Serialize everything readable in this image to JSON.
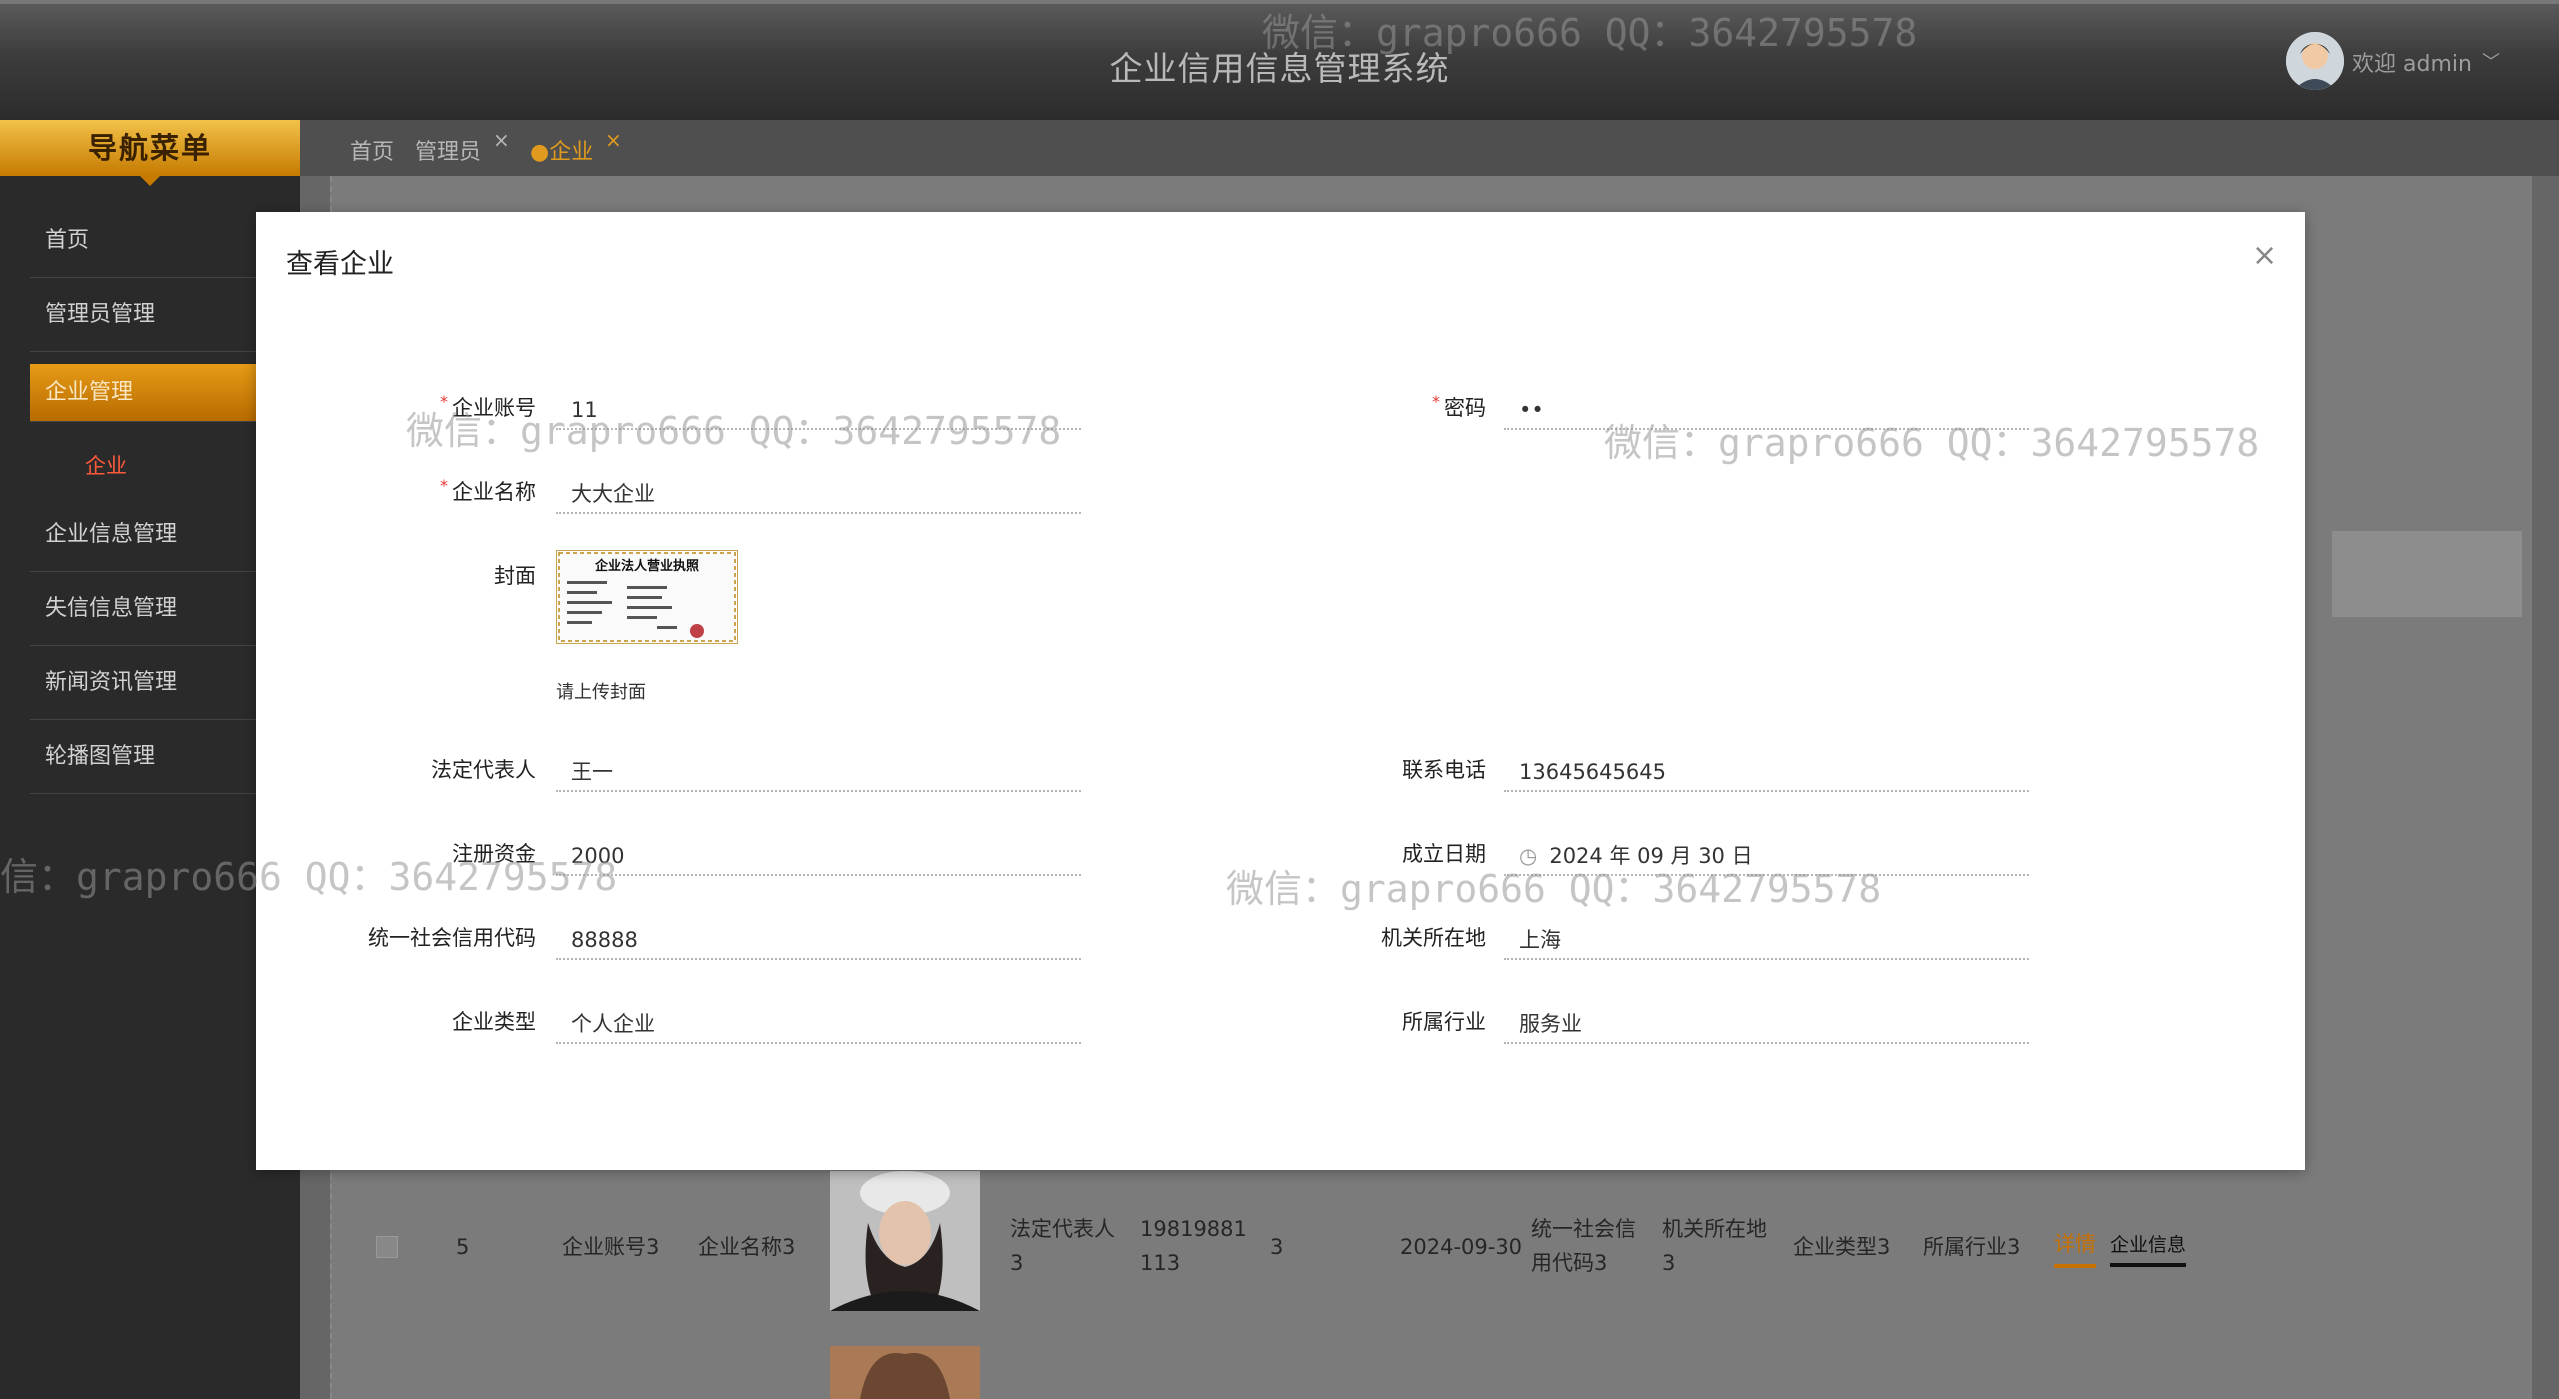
{
  "header": {
    "title": "企业信用信息管理系统",
    "welcome": "欢迎 admin",
    "caret": "﹀"
  },
  "sidebar": {
    "title": "导航菜单",
    "items": [
      {
        "label": "首页"
      },
      {
        "label": "管理员管理"
      },
      {
        "label": "企业管理"
      },
      {
        "label": "企业信息管理"
      },
      {
        "label": "失信信息管理"
      },
      {
        "label": "新闻资讯管理"
      },
      {
        "label": "轮播图管理"
      }
    ],
    "sub_item": "企业"
  },
  "tabs": [
    {
      "label": "首页"
    },
    {
      "label": "管理员"
    },
    {
      "label": "●企业"
    }
  ],
  "tab_close": "×",
  "dialog": {
    "title": "查看企业",
    "close": "×",
    "fields": {
      "account": {
        "label": "企业账号",
        "value": "11"
      },
      "password": {
        "label": "密码",
        "value": "••"
      },
      "name": {
        "label": "企业名称",
        "value": "大大企业"
      },
      "cover": {
        "label": "封面",
        "hint": "请上传封面",
        "image_title": "企业法人营业执照"
      },
      "legal_rep": {
        "label": "法定代表人",
        "value": "王一"
      },
      "phone": {
        "label": "联系电话",
        "value": "13645645645"
      },
      "capital": {
        "label": "注册资金",
        "value": "2000"
      },
      "founded": {
        "label": "成立日期",
        "value": "2024 年 09 月 30 日",
        "icon": "◷"
      },
      "credit_code": {
        "label": "统一社会信用代码",
        "value": "88888"
      },
      "location": {
        "label": "机关所在地",
        "value": "上海"
      },
      "type": {
        "label": "企业类型",
        "value": "个人企业"
      },
      "industry": {
        "label": "所属行业",
        "value": "服务业"
      }
    }
  },
  "table_row": {
    "index": "5",
    "account": "企业账号3",
    "name": "企业名称3",
    "legal_rep": "法定代表人3",
    "phone": "19819881113",
    "capital": "3",
    "date": "2024-09-30",
    "credit_code": "统一社会信用代码3",
    "location": "机关所在地3",
    "type": "企业类型3",
    "industry": "所属行业3",
    "detail": "详情",
    "info": "企业信息"
  },
  "watermark": "微信：grapro666 QQ：3642795578",
  "watermark_partial": "信：grapro666 QQ：3642795578",
  "colors": {
    "accent": "#e79b16",
    "active_sub": "#ff5a3a",
    "required": "#e53935"
  }
}
